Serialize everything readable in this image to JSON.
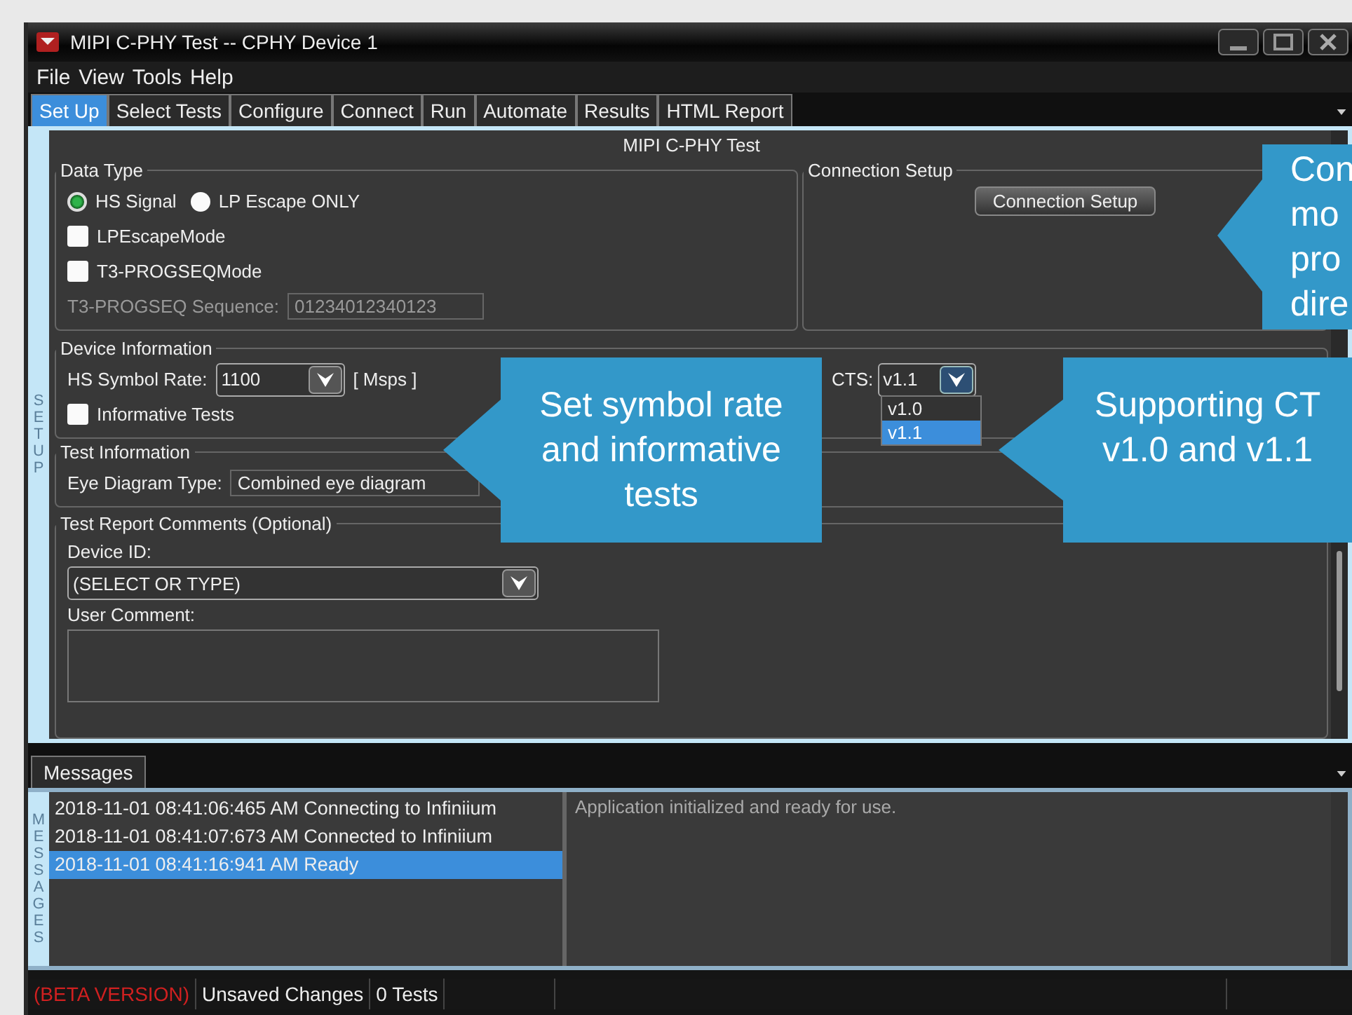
{
  "window": {
    "title": "MIPI C-PHY Test -- CPHY Device 1"
  },
  "menu": [
    "File",
    "View",
    "Tools",
    "Help"
  ],
  "tabs": [
    {
      "label": "Set Up",
      "selected": true
    },
    {
      "label": "Select Tests",
      "selected": false
    },
    {
      "label": "Configure",
      "selected": false
    },
    {
      "label": "Connect",
      "selected": false
    },
    {
      "label": "Run",
      "selected": false
    },
    {
      "label": "Automate",
      "selected": false
    },
    {
      "label": "Results",
      "selected": false
    },
    {
      "label": "HTML Report",
      "selected": false
    }
  ],
  "setup": {
    "side_label": "SET UP",
    "heading": "MIPI C-PHY Test",
    "data_type": {
      "title": "Data Type",
      "radios": [
        {
          "label": "HS Signal",
          "selected": true
        },
        {
          "label": "LP Escape ONLY",
          "selected": false
        }
      ],
      "checkboxes": [
        {
          "label": "LPEscapeMode",
          "checked": false
        },
        {
          "label": "T3-PROGSEQMode",
          "checked": false
        }
      ],
      "sequence": {
        "label": "T3-PROGSEQ Sequence:",
        "value": "01234012340123",
        "disabled": true
      }
    },
    "connection": {
      "title": "Connection Setup",
      "button": "Connection Setup"
    },
    "device": {
      "title": "Device Information",
      "rate_label": "HS Symbol Rate:",
      "rate_value": "1100",
      "rate_unit": "[ Msps ]",
      "informative": {
        "label": "Informative Tests",
        "checked": false
      },
      "cts": {
        "label": "CTS:",
        "value": "v1.1",
        "options": [
          {
            "label": "v1.0",
            "selected": false
          },
          {
            "label": "v1.1",
            "selected": true
          }
        ]
      }
    },
    "test_info": {
      "title": "Test Information",
      "eye_label": "Eye Diagram Type:",
      "eye_value": "Combined eye diagram"
    },
    "comments": {
      "title": "Test Report Comments (Optional)",
      "device_label": "Device ID:",
      "device_value": "(SELECT OR TYPE)",
      "comment_label": "User Comment:"
    }
  },
  "messages": {
    "tab": "Messages",
    "side_label": "MESSAGES",
    "log": [
      {
        "text": "2018-11-01 08:41:06:465 AM Connecting to Infiniium",
        "selected": false
      },
      {
        "text": "2018-11-01 08:41:07:673 AM Connected to Infiniium",
        "selected": false
      },
      {
        "text": "2018-11-01 08:41:16:941 AM Ready",
        "selected": true
      }
    ],
    "detail": "Application initialized and ready for use."
  },
  "status_bar": [
    {
      "text": "(BETA VERSION)",
      "kind": "warning"
    },
    {
      "text": "Unsaved Changes",
      "kind": "normal"
    },
    {
      "text": "0 Tests",
      "kind": "normal"
    }
  ],
  "callouts": [
    {
      "lines": [
        "Con",
        "mo",
        "pro",
        "dire"
      ]
    },
    {
      "lines": [
        "Set symbol rate",
        "and informative",
        "tests"
      ]
    },
    {
      "lines": [
        "Supporting CT",
        "v1.0 and v1.1"
      ]
    }
  ]
}
